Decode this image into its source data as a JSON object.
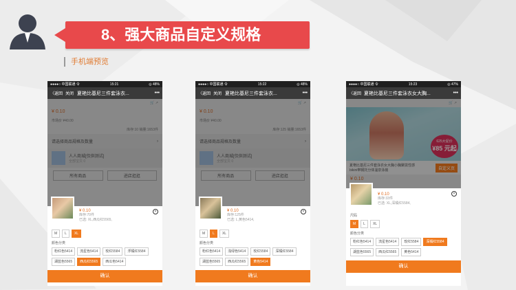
{
  "slide": {
    "title": "8、强大商品自定义规格",
    "subtitle": "手机端预览"
  },
  "colors": {
    "accent_red": "#e8494b",
    "accent_orange": "#f07a1e"
  },
  "phones": [
    {
      "status": {
        "carrier": "●●●●○ 中国联通 令",
        "time": "15:21",
        "battery": "◎ 48%"
      },
      "nav": {
        "back": "〈返回",
        "close": "关闭",
        "title": "夏艳比基尼三件套泳衣...",
        "more": "•••"
      },
      "bg": {
        "price": "¥ 0.10",
        "orig": "市场价 ¥40.00",
        "stock": "库存:10 销量:1653件",
        "select": "请选择商品规格及数量",
        "shop_name": "人人商城[仅供测试]",
        "shop_desc": "全部宝贝 0",
        "btn1": "所有商品",
        "btn2": "进店逛逛"
      },
      "sheet": {
        "price": "¥ 0.10",
        "stock": "库存:70件",
        "selected": "已选: XL,西瓜红5565,"
      },
      "size_label": "",
      "sizes": [
        "M",
        "L",
        "XL"
      ],
      "size_selected": 2,
      "color_label": "颜色分类",
      "colors": [
        "粉红色5414",
        "流星色5414",
        "玫红5584",
        "浮橘红5584",
        "湖蓝色5565",
        "西瓜红5565",
        "西瓜色5414"
      ],
      "color_selected": 5,
      "confirm": "确认"
    },
    {
      "status": {
        "carrier": "●●●●○ 中国联通 令",
        "time": "15:22",
        "battery": "◎ 48%"
      },
      "nav": {
        "back": "〈返回",
        "close": "关闭",
        "title": "夏艳比基尼三件套泳衣...",
        "more": "•••"
      },
      "bg": {
        "price": "¥ 0.10",
        "orig": "市场价 ¥40.00",
        "stock": "库存:125 销量:1653件",
        "select": "请选择商品规格及数量",
        "shop_name": "人人商城[仅供测试]",
        "shop_desc": "全部宝贝 0",
        "btn1": "所有商品",
        "btn2": "进店逛逛"
      },
      "sheet": {
        "price": "¥ 0.10",
        "stock": "库存:125件",
        "selected": "已选: L,黄色5414,"
      },
      "size_label": "",
      "sizes": [
        "M",
        "L",
        "XL"
      ],
      "size_selected": 1,
      "color_label": "颜色分类",
      "colors": [
        "粉红色5414",
        "浅绿色5414",
        "玫红5584",
        "深橘红5584",
        "湖蓝色5565",
        "西瓜红5565",
        "黄色5414"
      ],
      "color_selected": 6,
      "confirm": "确认"
    },
    {
      "status": {
        "carrier": "●●●●○ 中国联通 令",
        "time": "15:23",
        "battery": "◎ 47%"
      },
      "nav": {
        "back": "〈返回",
        "close": "",
        "title": "夏艳比基尼三件套泳衣女大胸...",
        "more": "•••"
      },
      "banner": {
        "badge_top": "625大促价",
        "badge_price": "¥85 元起"
      },
      "desc": {
        "text": "夏艳比基尼三件套泳衣女大胸小胸聚拢性感bikini带钢托分体温泉泳装",
        "tag": "自定义页"
      },
      "bg": {
        "price": "¥ 0.10",
        "orig": "市场价 ¥40.00"
      },
      "sheet": {
        "price": "¥ 0.10",
        "stock": "库存:33件",
        "selected": "已选: XL,深橘红5584,"
      },
      "size_label": "尺码",
      "sizes": [
        "M",
        "L",
        "XL"
      ],
      "size_selected": 0,
      "color_label": "颜色分类",
      "colors": [
        "粉红色5414",
        "流星色5414",
        "玫红5584",
        "深橘红5584",
        "湖蓝色5565",
        "西瓜红5565",
        "黄色5414"
      ],
      "color_selected": 3,
      "confirm": "确认"
    }
  ]
}
